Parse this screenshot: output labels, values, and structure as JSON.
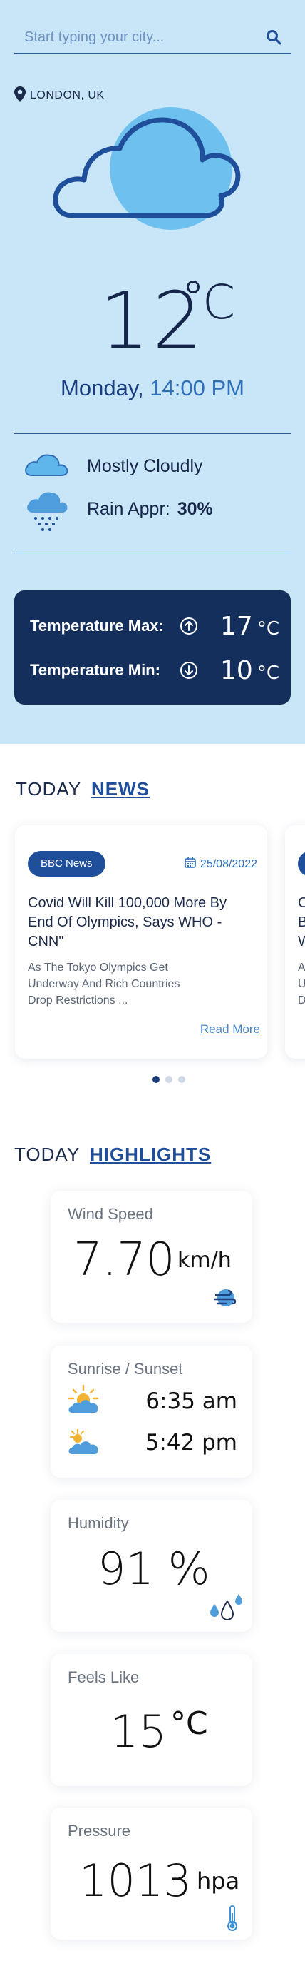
{
  "search": {
    "placeholder": "Start typing your city..."
  },
  "location": {
    "name": "LONDON, UK"
  },
  "current": {
    "temperature": "12",
    "unit": "C",
    "day": "Monday,",
    "time": "14:00 PM",
    "condition": "Mostly Cloudly",
    "rain_label": "Rain Appr:",
    "rain_value": "30%"
  },
  "minmax": {
    "max_label": "Temperature Max:",
    "max_value": "17",
    "min_label": "Temperature Min:",
    "min_value": "10",
    "unit": "°C"
  },
  "news": {
    "title_prefix": "TODAY",
    "title_accent": "NEWS",
    "articles": [
      {
        "source": "BBC News",
        "date": "25/08/2022",
        "title": "Covid Will Kill 100,000 More By End Of Olympics, Says WHO - CNN\"",
        "description": "As The Tokyo Olympics Get Underway And Rich Countries Drop Restrictions ...",
        "read_more": "Read More"
      }
    ],
    "peek_title_letters": "C\nB\nW",
    "peek_desc_letters": "A\nU\nD",
    "active_slide": 0,
    "slide_count": 3
  },
  "highlights": {
    "title_prefix": "TODAY",
    "title_accent": "HIGHLIGHTS",
    "wind": {
      "label": "Wind Speed",
      "value": "7.70",
      "unit": "km/h"
    },
    "sun": {
      "label": "Sunrise / Sunset",
      "sunrise": "6:35 am",
      "sunset": "5:42 pm"
    },
    "humidity": {
      "label": "Humidity",
      "value": "91 %"
    },
    "feels": {
      "label": "Feels Like",
      "value": "15",
      "unit": "°C"
    },
    "pressure": {
      "label": "Pressure",
      "value": "1013",
      "unit": "hpa"
    }
  },
  "colors": {
    "panel_bg": "#c8e6f7",
    "dark_card": "#142f5c",
    "accent": "#1f4f9a",
    "cloud_fill": "#6ec1ee"
  }
}
